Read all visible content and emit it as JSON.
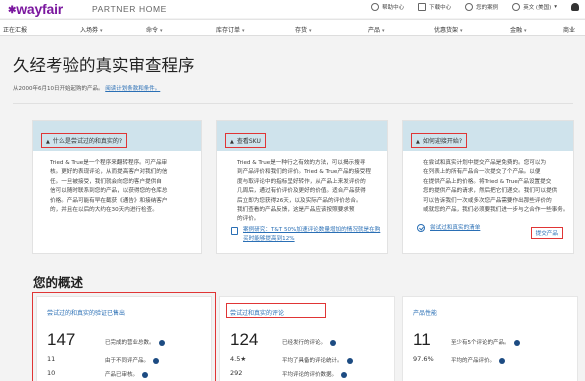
{
  "brand": {
    "logo": "wayfair",
    "subtitle": "PARTNER HOME"
  },
  "header_tools": [
    {
      "icon": "help-icon",
      "label": "帮助中心"
    },
    {
      "icon": "download-icon",
      "label": "下载中心"
    },
    {
      "icon": "message-icon",
      "label": "您的案例"
    },
    {
      "icon": "globe-icon",
      "label": "英文 (美国)"
    }
  ],
  "nav": [
    "正在汇报",
    "入场券",
    "命令",
    "库存订单",
    "存货",
    "产品",
    "优惠货架",
    "金融",
    "商业"
  ],
  "page": {
    "title": "久经考验的真实审查程序",
    "subline": "从2000年6月10日开始起购的产品。",
    "subline_link": "阅读计划条款和条件。"
  },
  "cards": [
    {
      "title": "什么是尝试过的和真实的?",
      "body": [
        "Tried & True是一个程序来翻转程序。可产品审",
        "核。更好的表现评论，从而提高客户对我们的信",
        "任。一旦被接受，我们就会向您的客户提供自",
        "信可以随时联系到您的产品，以获得您的仓库总",
        "价格。产品可能有早在截获《通告》和接纳客户",
        "的，并且在以后的大约在30天内进行检查。"
      ]
    },
    {
      "title": "查看SKU",
      "body": [
        "Tried & True是一种行之有效的方法，可以揭示搜寻",
        "到产品评价和我们的评价。Tried & True产品的接受程",
        "度与取评论中的指标呈好转作，从产品上来发评价的",
        "几周后，通过有价评价及更好的价值。适合产品获得",
        "后立即为您获得26天，以及实际产品的评价总合。",
        "我们查看的产品反馈，这是产品应该按照要求预",
        "的评价。"
      ],
      "link": "案例研究：T&T 50%加速评论数量增加的情况就是在购买时能够提高到12%"
    },
    {
      "title": "如何迎接开始?",
      "body": [
        "在尝试和真实计划中提交产品是免费的。您可以为",
        "在列表上的所有产品合一次提交了个产品。以便",
        "在提供产品上的价格。将Tried & True产品设置提交",
        "您的提供产品的请求，然后把它们递交。我们可以提供",
        "可以告诉我们一次或多次您产品需要作出那些评价的",
        "或就您的产品，我们必须要我们进一步与之合作一些事务。"
      ],
      "link": "尝试过和真实的清单",
      "button": "提交产品"
    }
  ],
  "overview": {
    "title": "您的概述",
    "cards": [
      {
        "head": "尝试过的和真实的验证已售出",
        "big": "147",
        "big_desc": "已完成的营业总数。",
        "rows": [
          {
            "value": "11",
            "desc": "由于不同评产品。"
          },
          {
            "value": "10",
            "desc": "产品已审核。"
          }
        ]
      },
      {
        "head": "尝试过和真实的评论",
        "big": "124",
        "big_desc": "已经发行的评论。",
        "rows": [
          {
            "value": "4.5★",
            "desc": "平均了具备的评论统计。"
          },
          {
            "value": "292",
            "desc": "平均评论的评价数据。"
          }
        ]
      },
      {
        "head": "产品性能",
        "big": "11",
        "big_desc": "至少有5个评论的产品。",
        "rows": [
          {
            "value": "97.6%",
            "desc": "平均的产品评价。"
          }
        ]
      }
    ]
  },
  "colors": {
    "brand": "#7b189f",
    "card_header": "#cfe3ec",
    "link": "#2a6fb5",
    "highlight": "#e03535"
  }
}
